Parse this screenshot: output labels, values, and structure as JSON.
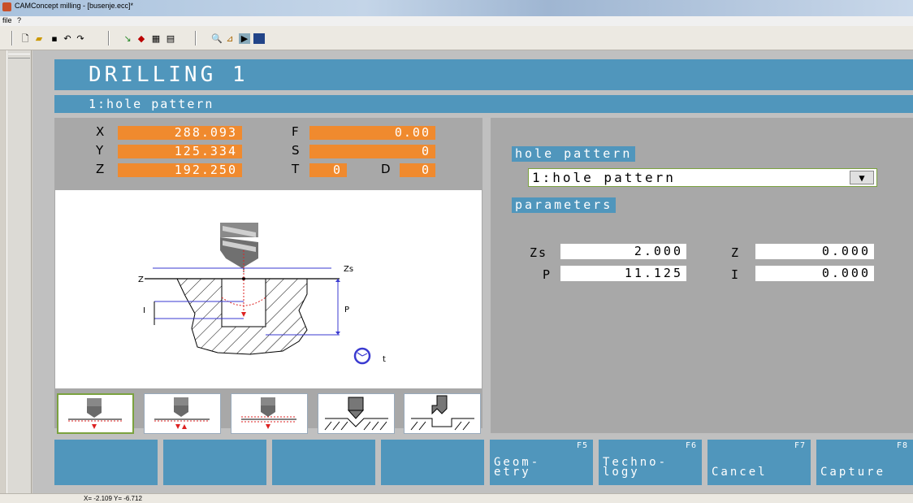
{
  "window": {
    "title": "CAMConcept milling - [busenje.ecc]*"
  },
  "menu": [
    "file",
    "?"
  ],
  "toolbar": {
    "icons": [
      "new-file-icon",
      "open-folder-icon",
      "save-icon",
      "undo-icon",
      "redo-icon",
      "select-icon",
      "pointer-icon",
      "grid-icon",
      "layout-icon",
      "zoom-icon",
      "measure-icon",
      "cursor-icon",
      "view-icon"
    ]
  },
  "header": {
    "title": "DRILLING 1",
    "subtitle": "1:hole pattern"
  },
  "coords": {
    "x_label": "X",
    "x_value": "288.093",
    "y_label": "Y",
    "y_value": "125.334",
    "z_label": "Z",
    "z_value": "192.250",
    "f_label": "F",
    "f_value": "0.00",
    "s_label": "S",
    "s_value": "0",
    "t_label": "T",
    "t_value": "0",
    "d_label": "D",
    "d_value": "0"
  },
  "diagram": {
    "labels": {
      "zs": "Zs",
      "z": "Z",
      "i": "I",
      "p": "P",
      "t": "t"
    }
  },
  "cycles": [
    "drill-simple-icon",
    "drill-peck-icon",
    "drill-chipbreak-icon",
    "countersink-icon",
    "counterbore-icon"
  ],
  "right": {
    "hole_pattern_label": "hole pattern",
    "hole_pattern_value": "1:hole pattern",
    "parameters_label": "parameters",
    "params": {
      "zs_label": "Zs",
      "zs_value": "2.000",
      "z_label": "Z",
      "z_value": "0.000",
      "p_label": "P",
      "p_value": "11.125",
      "i_label": "I",
      "i_value": "0.000"
    }
  },
  "softkeys": [
    {
      "key": "",
      "label": ""
    },
    {
      "key": "",
      "label": ""
    },
    {
      "key": "",
      "label": ""
    },
    {
      "key": "",
      "label": ""
    },
    {
      "key": "F5",
      "label": "Geom-\netry"
    },
    {
      "key": "F6",
      "label": "Techno-\nlogy"
    },
    {
      "key": "F7",
      "label": "Cancel"
    },
    {
      "key": "F8",
      "label": "Capture"
    }
  ],
  "status": {
    "coords": "X= -2.109 Y= -6.712"
  }
}
